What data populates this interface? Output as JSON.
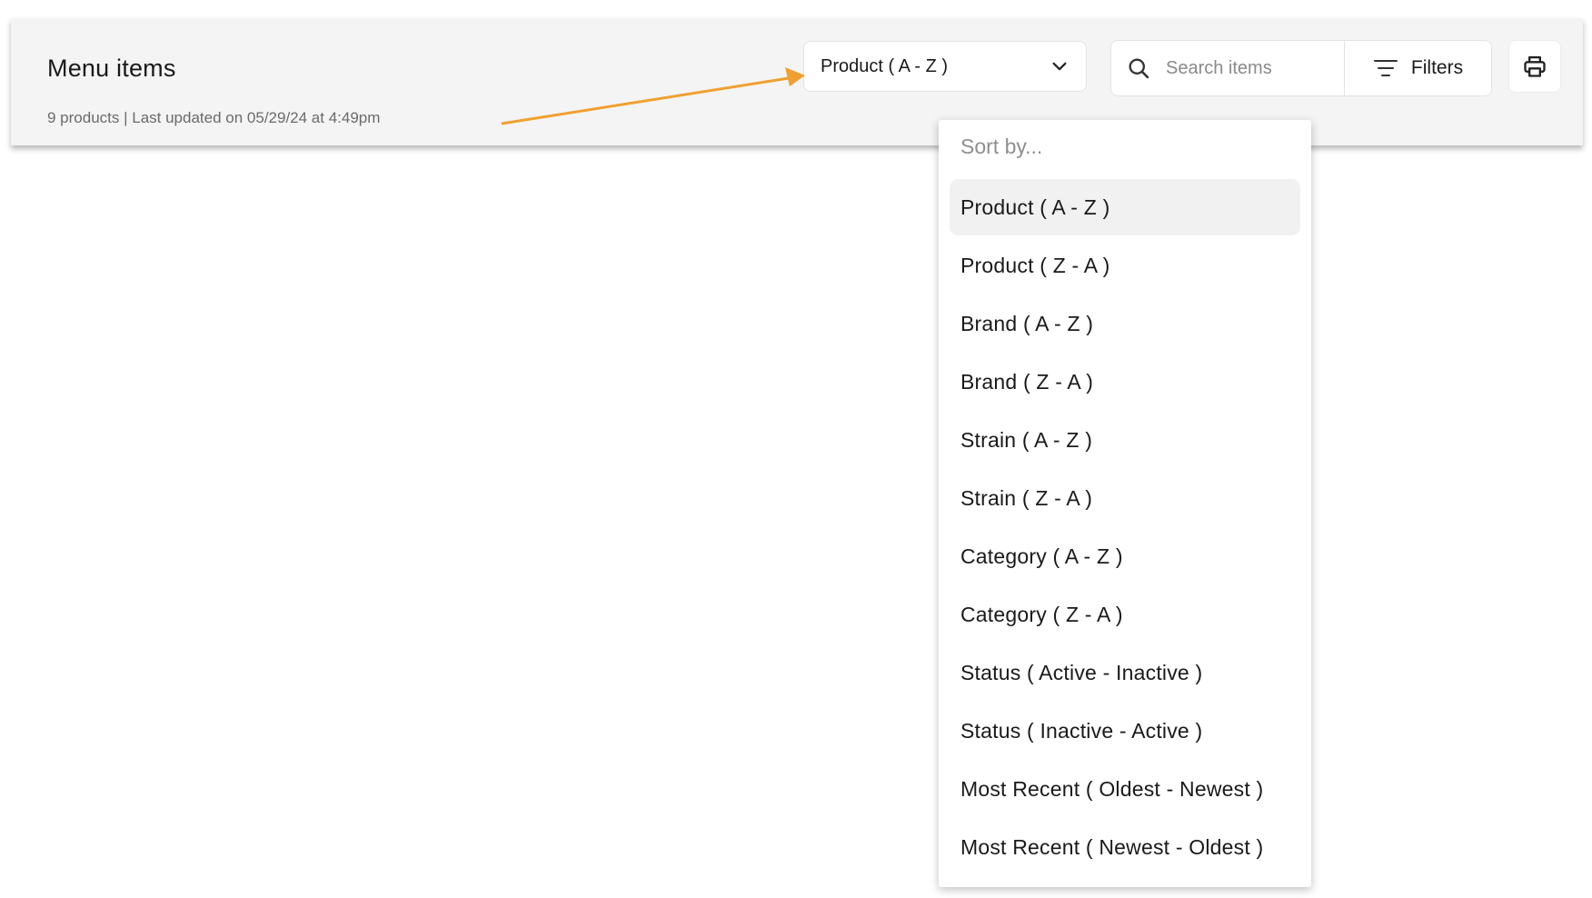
{
  "header": {
    "title": "Menu items",
    "subtitle": "9 products | Last updated on 05/29/24 at 4:49pm"
  },
  "sort": {
    "selected_label": "Product ( A - Z )",
    "menu_header": "Sort by...",
    "options": [
      "Product ( A - Z )",
      "Product ( Z - A )",
      "Brand ( A - Z )",
      "Brand ( Z - A )",
      "Strain ( A - Z )",
      "Strain ( Z - A )",
      "Category ( A - Z )",
      "Category ( Z - A )",
      "Status ( Active - Inactive )",
      "Status ( Inactive - Active )",
      "Most Recent ( Oldest - Newest )",
      "Most Recent ( Newest - Oldest )"
    ],
    "selected_index": 0
  },
  "search": {
    "placeholder": "Search items",
    "value": ""
  },
  "filters": {
    "label": "Filters"
  },
  "icons": {
    "sort_chevron": "chevron-down-icon",
    "search": "search-icon",
    "filters": "filter-icon",
    "print": "print-icon"
  },
  "colors": {
    "annotation_arrow": "#f0a030",
    "header_background": "#f4f4f4",
    "selected_option_background": "#f1f1f1"
  }
}
